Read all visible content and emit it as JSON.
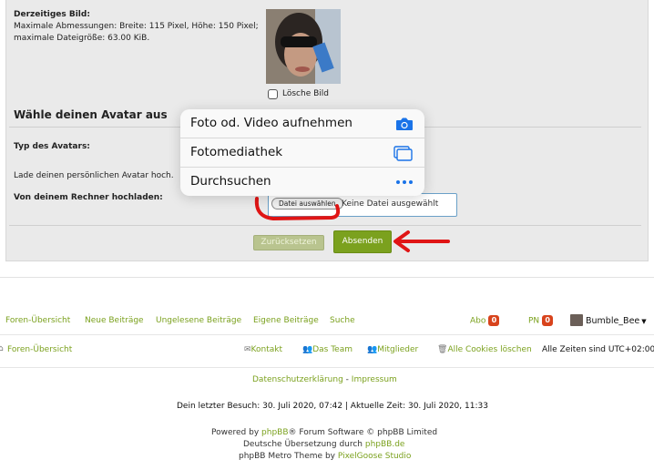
{
  "current_image": {
    "label": "Derzeitiges Bild:",
    "dimensions": "Maximale Abmessungen: Breite: 115 Pixel, Höhe: 150 Pixel;",
    "filesize": "maximale Dateigröße: 63.00 KiB.",
    "delete_label": "Lösche Bild"
  },
  "avatar_section": {
    "title": "Wähle deinen Avatar aus",
    "type_label": "Typ des Avatars:",
    "upload_hint": "Lade deinen persönlichen Avatar hoch.",
    "upload_label": "Von deinem Rechner hochladen:",
    "file_button": "Datei auswählen",
    "file_status": "Keine Datei ausgewählt"
  },
  "buttons": {
    "reset": "Zurücksetzen",
    "submit": "Absenden"
  },
  "popup": {
    "items": [
      {
        "label": "Foto od. Video aufnehmen",
        "icon": "camera-icon"
      },
      {
        "label": "Fotomediathek",
        "icon": "photo-library-icon"
      },
      {
        "label": "Durchsuchen",
        "icon": "more-icon"
      }
    ]
  },
  "nav": {
    "links": [
      "Foren-Übersicht",
      "Neue Beiträge",
      "Ungelesene Beiträge",
      "Eigene Beiträge",
      "Suche"
    ],
    "abo_label": "Abo",
    "abo_count": "0",
    "pn_label": "PN",
    "pn_count": "0",
    "username": "Bumble_Bee"
  },
  "subnav": {
    "index": "Foren-Übersicht",
    "contact": "Kontakt",
    "team": "Das Team",
    "members": "Mitglieder",
    "cookies": "Alle Cookies löschen",
    "timezone": "Alle Zeiten sind UTC+02:00"
  },
  "footer": {
    "privacy": "Datenschutzerklärung",
    "separator": " - ",
    "imprint": "Impressum",
    "visit": "Dein letzter Besuch: 30. Juli 2020, 07:42 | Aktuelle Zeit: 30. Juli 2020, 11:33",
    "powered_prefix": "Powered by ",
    "powered_link": "phpBB",
    "powered_suffix": "® Forum Software © phpBB Limited",
    "translation_prefix": "Deutsche Übersetzung durch ",
    "translation_link": "phpBB.de",
    "theme_prefix": "phpBB Metro Theme by ",
    "theme_link": "PixelGoose Studio"
  },
  "colors": {
    "accent_green": "#7ba11e",
    "badge_red": "#d8431c",
    "annotation_red": "#e01515",
    "ios_blue": "#1a73e8"
  }
}
